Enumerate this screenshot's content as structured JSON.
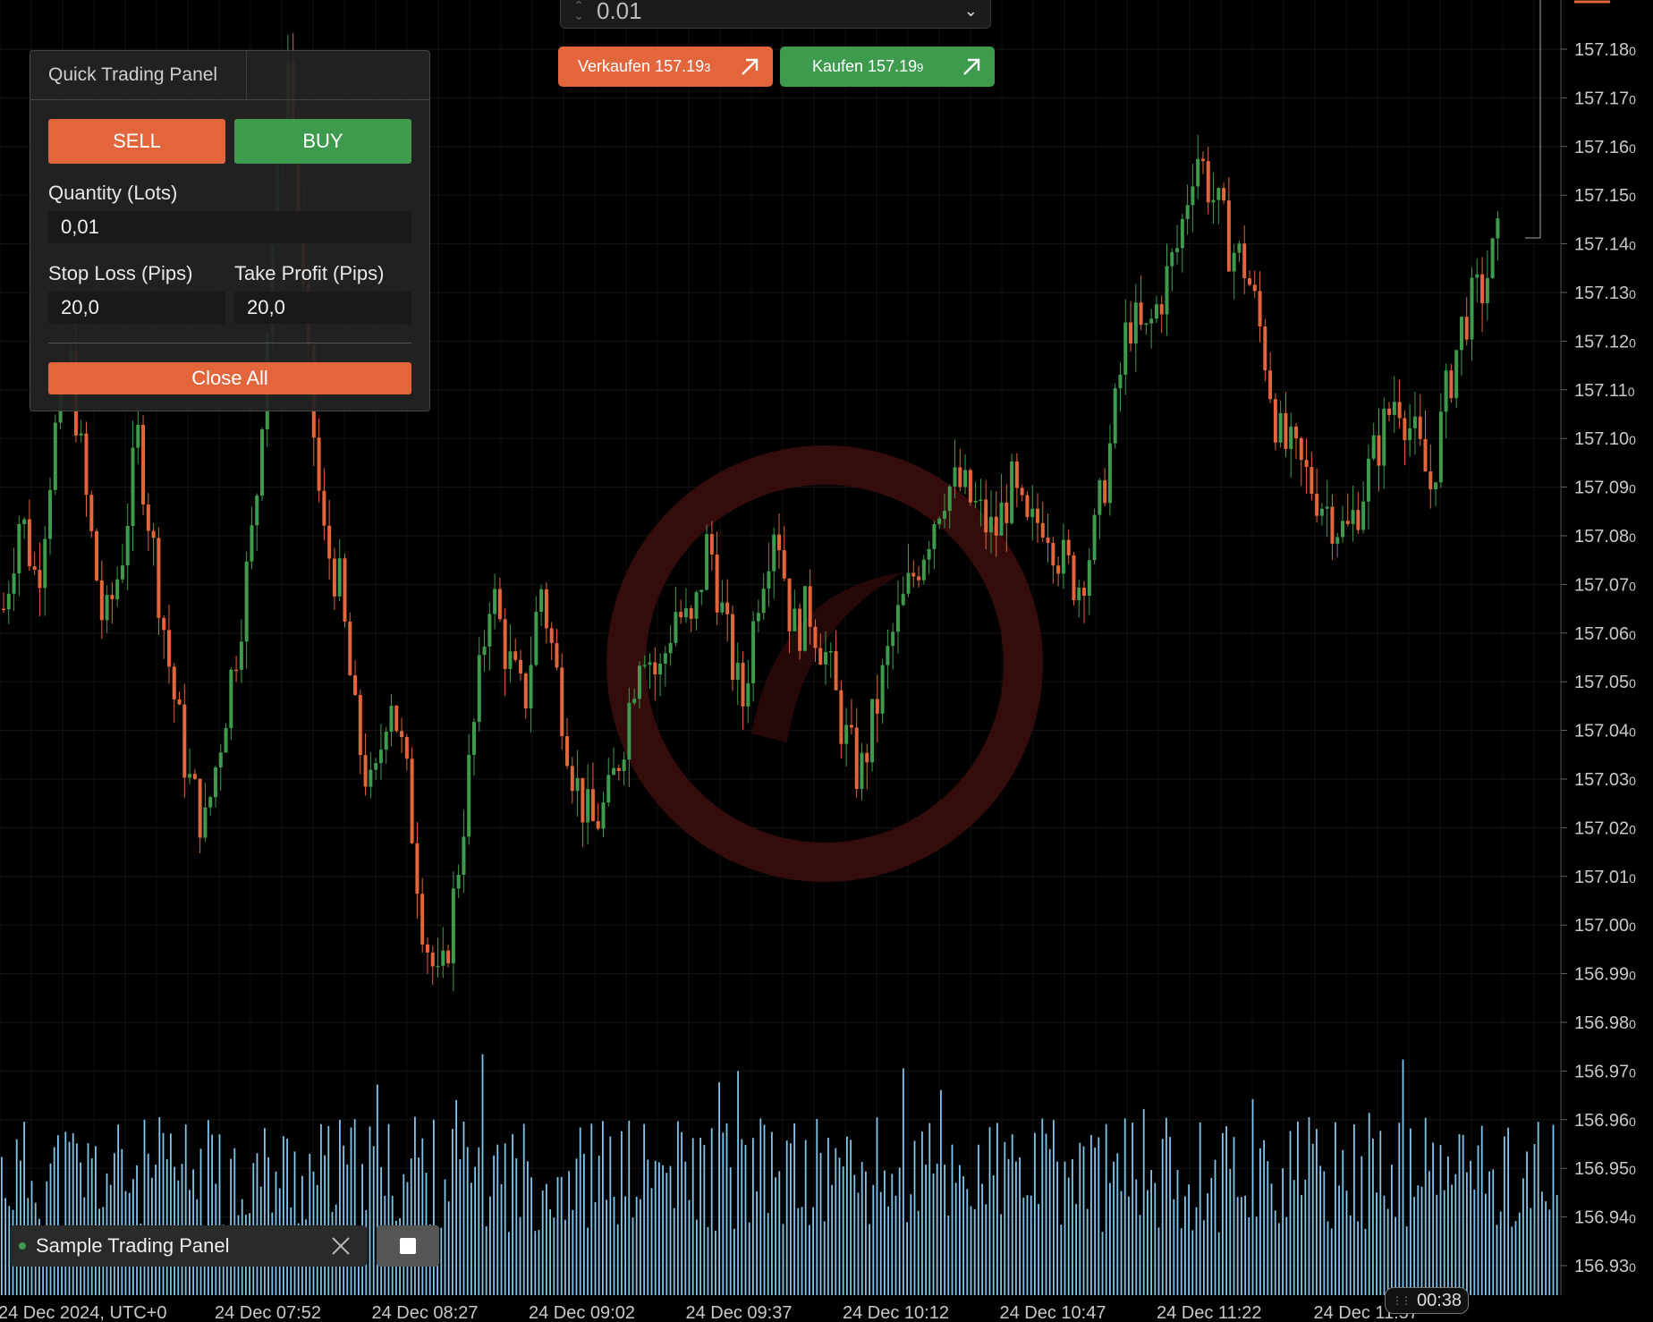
{
  "top_bar": {
    "quantity_value": "0.01",
    "sell_label": "Verkaufen 157.19",
    "sell_pip": "3",
    "buy_label": "Kaufen 157.19",
    "buy_pip": "9"
  },
  "quick_panel": {
    "title": "Quick Trading Panel",
    "sell_button": "SELL",
    "buy_button": "BUY",
    "quantity_label": "Quantity (Lots)",
    "quantity_value": "0,01",
    "stop_loss_label": "Stop Loss (Pips)",
    "stop_loss_value": "20,0",
    "take_profit_label": "Take Profit (Pips)",
    "take_profit_value": "20,0",
    "close_all_button": "Close All"
  },
  "bottom": {
    "panel_tab_name": "Sample Trading Panel",
    "timer": "00:38"
  },
  "colors": {
    "sell": "#e2653b",
    "buy": "#3e9a4d",
    "volume": "#7fc4ea",
    "watermark": "#5a1414"
  },
  "chart_data": {
    "type": "candlestick",
    "price_axis": {
      "ticks": [
        "157.18",
        "157.17",
        "157.16",
        "157.15",
        "157.14",
        "157.13",
        "157.12",
        "157.11",
        "157.10",
        "157.09",
        "157.08",
        "157.07",
        "157.06",
        "157.05",
        "157.04",
        "157.03",
        "157.02",
        "157.01",
        "157.00",
        "156.99",
        "156.98",
        "156.97",
        "156.96",
        "156.95",
        "156.94",
        "156.93"
      ],
      "last_digit": "0",
      "range": [
        156.925,
        157.19
      ]
    },
    "time_axis": {
      "ticks": [
        "24 Dec 2024, UTC+0",
        "24 Dec 07:52",
        "24 Dec 08:27",
        "24 Dec 09:02",
        "24 Dec 09:37",
        "24 Dec 10:12",
        "24 Dec 10:47",
        "24 Dec 11:22",
        "24 Dec 11:57"
      ]
    },
    "close_path": [
      157.065,
      157.085,
      157.07,
      157.1,
      157.115,
      157.085,
      157.06,
      157.075,
      157.1,
      157.075,
      157.05,
      157.03,
      157.02,
      157.04,
      157.06,
      157.085,
      157.14,
      157.18,
      157.12,
      157.08,
      157.07,
      157.04,
      157.025,
      157.05,
      157.03,
      157.0,
      156.985,
      157.01,
      157.04,
      157.07,
      157.055,
      157.045,
      157.07,
      157.05,
      157.03,
      157.02,
      157.025,
      157.04,
      157.06,
      157.05,
      157.065,
      157.06,
      157.08,
      157.06,
      157.045,
      157.07,
      157.085,
      157.06,
      157.065,
      157.055,
      157.04,
      157.03,
      157.045,
      157.06,
      157.07,
      157.08,
      157.09,
      157.09,
      157.085,
      157.08,
      157.09,
      157.08,
      157.085,
      157.075,
      157.07,
      157.08,
      157.1,
      157.125,
      157.12,
      157.13,
      157.14,
      157.16,
      157.15,
      157.14,
      157.135,
      157.12,
      157.1,
      157.095,
      157.09,
      157.085,
      157.08,
      157.09,
      157.1,
      157.11,
      157.1,
      157.09,
      157.11,
      157.125,
      157.13,
      157.14
    ]
  }
}
